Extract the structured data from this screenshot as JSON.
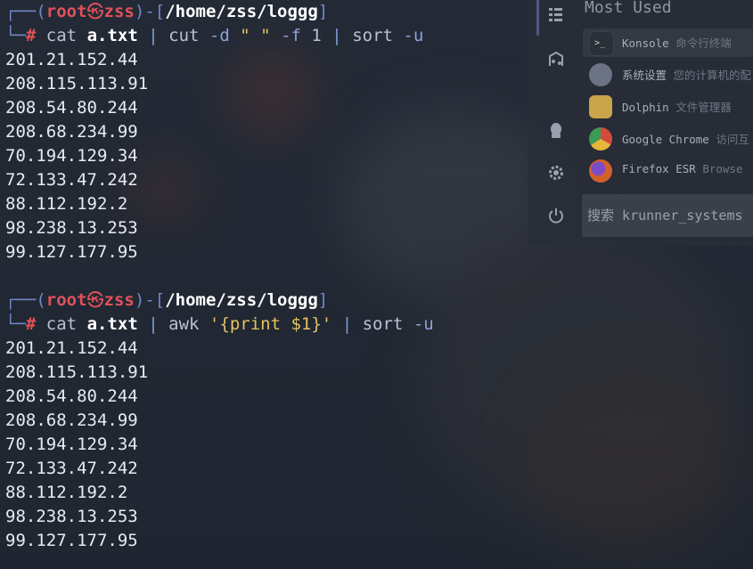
{
  "colors": {
    "prompt": "#6f87c9",
    "user": "#e0515a",
    "path": "#ffffff",
    "output": "#e8ebf1",
    "pipe": "#7f9cd6",
    "string": "#e6c35c"
  },
  "prompt": {
    "open": "┌──(",
    "user": "root",
    "at": "㉿",
    "host": "zss",
    "close": ")-[",
    "path": "/home/zss/loggg",
    "end": "]",
    "corner": "└─",
    "hash": "#"
  },
  "block1": {
    "cmd_cat": "cat",
    "file": "a.txt",
    "pipe1": "|",
    "cmd_cut": "cut",
    "opt_d": "-d",
    "delim": "\" \"",
    "opt_f": "-f",
    "field": "1",
    "pipe2": "|",
    "cmd_sort": "sort",
    "opt_u": "-u",
    "output": [
      "201.21.152.44",
      "208.115.113.91",
      "208.54.80.244",
      "208.68.234.99",
      "70.194.129.34",
      "72.133.47.242",
      "88.112.192.2",
      "98.238.13.253",
      "99.127.177.95"
    ]
  },
  "block2": {
    "cmd_cat": "cat",
    "file": "a.txt",
    "pipe1": "|",
    "cmd_awk": "awk",
    "quote_open": "'",
    "brace_open": "{",
    "awk_prog": "print $1",
    "brace_close": "}",
    "quote_close": "'",
    "pipe2": "|",
    "cmd_sort": "sort",
    "opt_u": "-u",
    "output": [
      "201.21.152.44",
      "208.115.113.91",
      "208.54.80.244",
      "208.68.234.99",
      "70.194.129.34",
      "72.133.47.242",
      "88.112.192.2",
      "98.238.13.253",
      "99.127.177.95"
    ]
  },
  "launcher": {
    "section_title": "Most Used",
    "sidebar_icons": [
      "favorites-icon",
      "applications-icon",
      "computer-icon",
      "settings-icon",
      "power-icon"
    ],
    "apps": [
      {
        "name": "Konsole",
        "desc": "命令行终端",
        "icon": "terminal-icon",
        "color": "#2b2f37"
      },
      {
        "name": "系统设置",
        "desc": "您的计算机的配",
        "icon": "settings-app-icon",
        "color": "#6b7384"
      },
      {
        "name": "Dolphin",
        "desc": "文件管理器",
        "icon": "folder-icon",
        "color": "#c9a44a"
      },
      {
        "name": "Google Chrome",
        "desc": "访问互",
        "icon": "chrome-icon",
        "color": "#d34a3f"
      },
      {
        "name": "Firefox ESR",
        "desc": "Browse",
        "icon": "firefox-icon",
        "color": "#d1602b"
      }
    ],
    "search_label": "搜索",
    "search_query": "krunner_systems"
  }
}
